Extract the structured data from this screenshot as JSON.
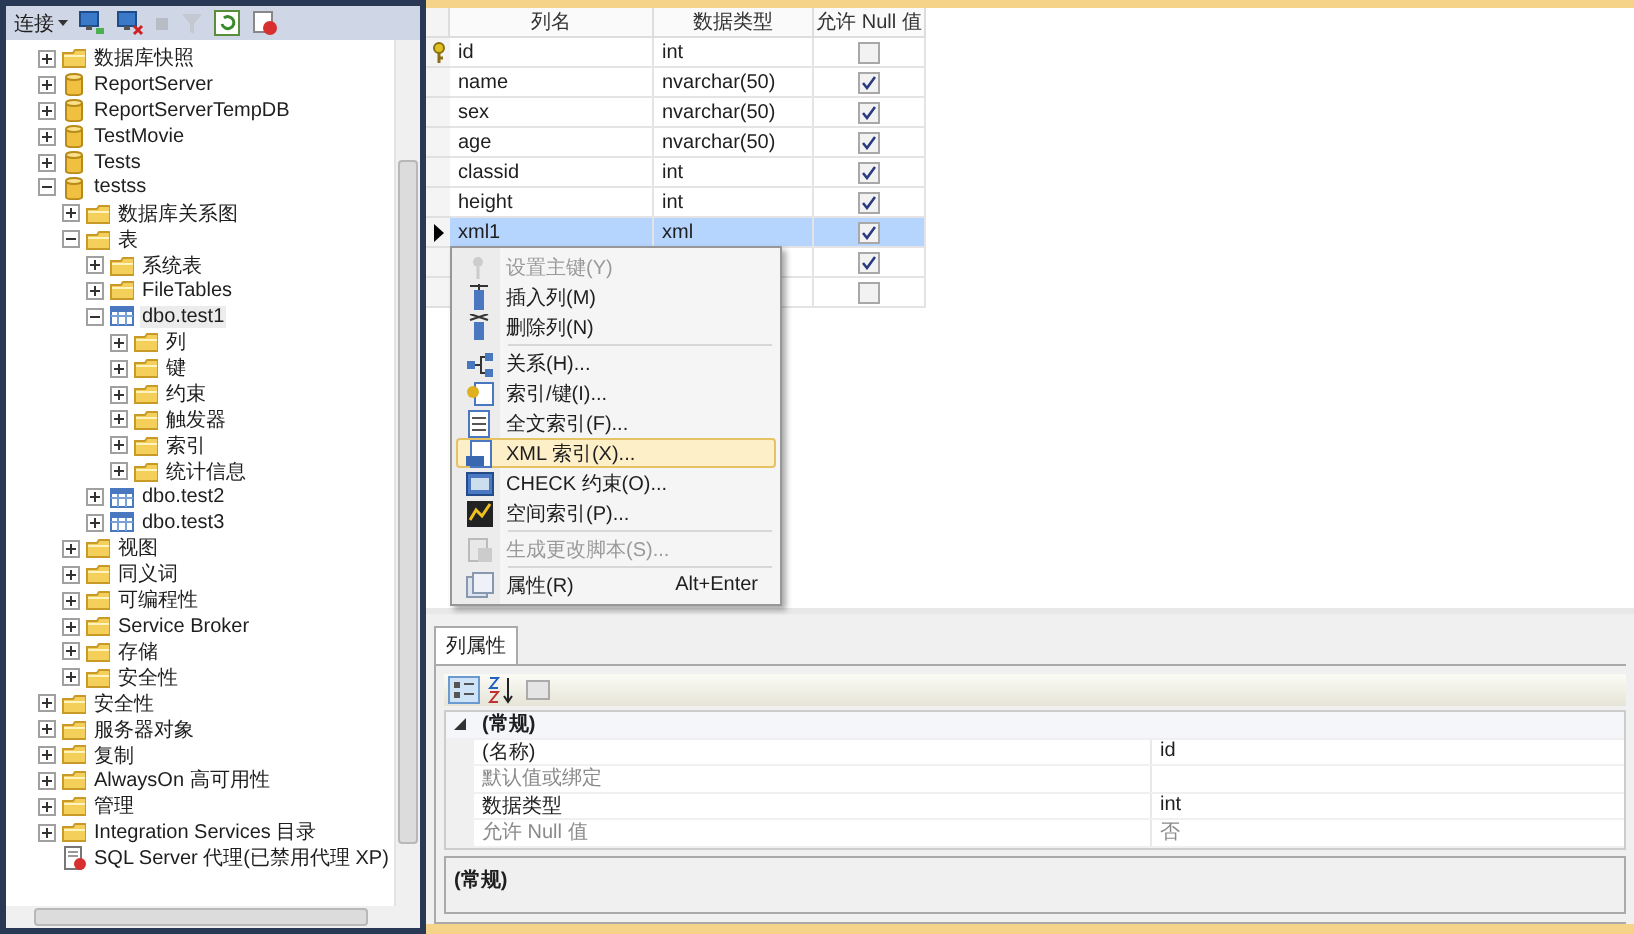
{
  "explorer": {
    "toolbar": {
      "connect": "连接"
    },
    "tree": [
      {
        "children": [
          {
            "label": "数据库快照",
            "kind": "folder",
            "expanded": false,
            "selected": false
          },
          {
            "label": "ReportServer",
            "kind": "database",
            "expanded": false,
            "selected": false
          },
          {
            "label": "ReportServerTempDB",
            "kind": "database",
            "expanded": false,
            "selected": false
          },
          {
            "label": "TestMovie",
            "kind": "database",
            "expanded": false,
            "selected": false
          },
          {
            "label": "Tests",
            "kind": "database",
            "expanded": false,
            "selected": false
          },
          {
            "label": "testss",
            "kind": "database",
            "expanded": true,
            "selected": false,
            "children": [
              {
                "label": "数据库关系图",
                "kind": "folder",
                "expanded": false,
                "selected": false
              },
              {
                "label": "表",
                "kind": "folder",
                "expanded": true,
                "selected": false,
                "children": [
                  {
                    "label": "系统表",
                    "kind": "folder",
                    "expanded": false,
                    "selected": false
                  },
                  {
                    "label": "FileTables",
                    "kind": "folder",
                    "expanded": false,
                    "selected": false
                  },
                  {
                    "label": "dbo.test1",
                    "kind": "table",
                    "expanded": true,
                    "selected": true,
                    "children": [
                      {
                        "label": "列",
                        "kind": "folder",
                        "expanded": false,
                        "selected": false
                      },
                      {
                        "label": "键",
                        "kind": "folder",
                        "expanded": false,
                        "selected": false
                      },
                      {
                        "label": "约束",
                        "kind": "folder",
                        "expanded": false,
                        "selected": false
                      },
                      {
                        "label": "触发器",
                        "kind": "folder",
                        "expanded": false,
                        "selected": false
                      },
                      {
                        "label": "索引",
                        "kind": "folder",
                        "expanded": false,
                        "selected": false
                      },
                      {
                        "label": "统计信息",
                        "kind": "folder",
                        "expanded": false,
                        "selected": false
                      }
                    ]
                  },
                  {
                    "label": "dbo.test2",
                    "kind": "table",
                    "expanded": false,
                    "selected": false
                  },
                  {
                    "label": "dbo.test3",
                    "kind": "table",
                    "expanded": false,
                    "selected": false
                  }
                ]
              },
              {
                "label": "视图",
                "kind": "folder",
                "expanded": false,
                "selected": false
              },
              {
                "label": "同义词",
                "kind": "folder",
                "expanded": false,
                "selected": false
              },
              {
                "label": "可编程性",
                "kind": "folder",
                "expanded": false,
                "selected": false
              },
              {
                "label": "Service Broker",
                "kind": "folder",
                "expanded": false,
                "selected": false
              },
              {
                "label": "存储",
                "kind": "folder",
                "expanded": false,
                "selected": false
              },
              {
                "label": "安全性",
                "kind": "folder",
                "expanded": false,
                "selected": false
              }
            ]
          }
        ]
      },
      {
        "label": "安全性",
        "kind": "folder",
        "expanded": false,
        "selected": false
      },
      {
        "label": "服务器对象",
        "kind": "folder",
        "expanded": false,
        "selected": false
      },
      {
        "label": "复制",
        "kind": "folder",
        "expanded": false,
        "selected": false
      },
      {
        "label": "AlwaysOn 高可用性",
        "kind": "folder",
        "expanded": false,
        "selected": false
      },
      {
        "label": "管理",
        "kind": "folder",
        "expanded": false,
        "selected": false
      },
      {
        "label": "Integration Services 目录",
        "kind": "folder",
        "expanded": false,
        "selected": false
      },
      {
        "label": "SQL Server 代理(已禁用代理 XP)",
        "kind": "agent",
        "selected": false
      }
    ]
  },
  "table": {
    "columns": [
      "列名",
      "数据类型",
      "允许 Null 值"
    ],
    "rows": [
      {
        "name": "id",
        "type": "int",
        "allow_null": false,
        "primary_key": true,
        "selected": false
      },
      {
        "name": "name",
        "type": "nvarchar(50)",
        "allow_null": true,
        "primary_key": false,
        "selected": false
      },
      {
        "name": "sex",
        "type": "nvarchar(50)",
        "allow_null": true,
        "primary_key": false,
        "selected": false
      },
      {
        "name": "age",
        "type": "nvarchar(50)",
        "allow_null": true,
        "primary_key": false,
        "selected": false
      },
      {
        "name": "classid",
        "type": "int",
        "allow_null": true,
        "primary_key": false,
        "selected": false
      },
      {
        "name": "height",
        "type": "int",
        "allow_null": true,
        "primary_key": false,
        "selected": false
      },
      {
        "name": "xml1",
        "type": "xml",
        "allow_null": true,
        "primary_key": false,
        "selected": true
      },
      {
        "allow_null": true,
        "primary_key": false,
        "selected": false
      },
      {
        "allow_null": false,
        "primary_key": false,
        "selected": false
      }
    ]
  },
  "context_menu": [
    {
      "kind": "item",
      "label": "设置主键(Y)",
      "disabled": true,
      "selected": false
    },
    {
      "kind": "item",
      "label": "插入列(M)",
      "disabled": false,
      "selected": false
    },
    {
      "kind": "item",
      "label": "删除列(N)",
      "disabled": false,
      "selected": false
    },
    {
      "kind": "separator"
    },
    {
      "kind": "item",
      "label": "关系(H)...",
      "disabled": false,
      "selected": false
    },
    {
      "kind": "item",
      "label": "索引/键(I)...",
      "disabled": false,
      "selected": false
    },
    {
      "kind": "item",
      "label": "全文索引(F)...",
      "disabled": false,
      "selected": false
    },
    {
      "kind": "item",
      "label": "XML 索引(X)...",
      "disabled": false,
      "selected": true
    },
    {
      "kind": "item",
      "label": "CHECK 约束(O)...",
      "disabled": false,
      "selected": false
    },
    {
      "kind": "item",
      "label": "空间索引(P)...",
      "disabled": false,
      "selected": false
    },
    {
      "kind": "separator"
    },
    {
      "kind": "item",
      "label": "生成更改脚本(S)...",
      "disabled": true,
      "selected": false
    },
    {
      "kind": "separator"
    },
    {
      "kind": "item",
      "label": "属性(R)",
      "shortcut": "Alt+Enter",
      "disabled": false,
      "selected": false
    }
  ],
  "properties": {
    "tab": "列属性",
    "category": "(常规)",
    "category_expanded": true,
    "rows": [
      {
        "name": "(名称)",
        "value": "id",
        "disabled": false
      },
      {
        "name": "默认值或绑定",
        "disabled": true
      },
      {
        "name": "数据类型",
        "value": "int",
        "disabled": false
      },
      {
        "name": "允许 Null 值",
        "value": "否",
        "disabled": true
      }
    ],
    "description": "(常规)"
  }
}
